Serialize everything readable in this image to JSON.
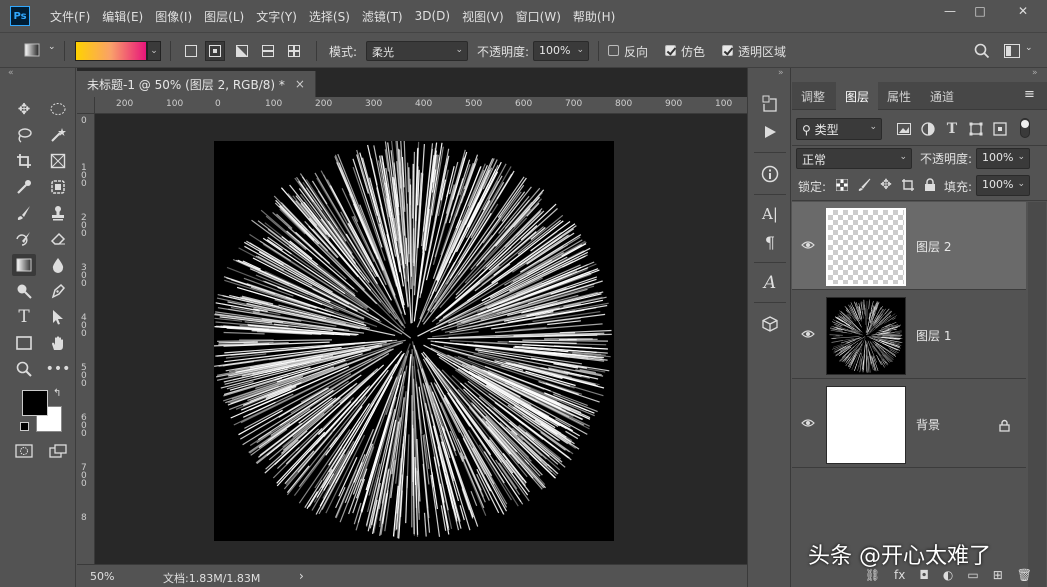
{
  "app": {
    "logo": "Ps"
  },
  "menu": [
    "文件(F)",
    "编辑(E)",
    "图像(I)",
    "图层(L)",
    "文字(Y)",
    "选择(S)",
    "滤镜(T)",
    "3D(D)",
    "视图(V)",
    "窗口(W)",
    "帮助(H)"
  ],
  "window_controls": {
    "minimize": "—",
    "restore": "□",
    "close": "✕"
  },
  "options": {
    "mode_label": "模式:",
    "mode_value": "柔光",
    "opacity_label": "不透明度:",
    "opacity_value": "100%",
    "reverse_label": "反向",
    "dither_label": "仿色",
    "transparency_label": "透明区域",
    "gradient_colors": [
      "#ffd200",
      "#f9a06a",
      "#e8157a"
    ]
  },
  "document": {
    "tab_title": "未标题-1 @ 50% (图层 2, RGB/8) *",
    "close": "×",
    "ruler_h_labels": [
      "200",
      "100",
      "0",
      "100",
      "200",
      "300",
      "400",
      "500",
      "600",
      "700",
      "800",
      "900",
      "100"
    ],
    "ruler_v_labels": [
      "0",
      "1 0 0",
      "2 0 0",
      "3 0 0",
      "4 0 0",
      "5 0 0",
      "6 0 0",
      "7 0 0",
      "8"
    ],
    "zoom": "50%",
    "doc_info": "文档:1.83M/1.83M",
    "status_arrow": "›"
  },
  "layers_panel": {
    "tabs": [
      "调整",
      "图层",
      "属性",
      "通道"
    ],
    "active_tab": "图层",
    "filter_label": "类型",
    "blend_mode": "正常",
    "opacity_label": "不透明度:",
    "opacity_value": "100%",
    "lock_label": "锁定:",
    "fill_label": "填充:",
    "fill_value": "100%",
    "layers": [
      {
        "name": "图层 2",
        "selected": true,
        "thumb": "transparent"
      },
      {
        "name": "图层 1",
        "selected": false,
        "thumb": "burst"
      },
      {
        "name": "背景",
        "selected": false,
        "thumb": "white",
        "locked": true
      }
    ]
  },
  "watermark": "头条 @开心太难了",
  "colors": {
    "panel": "#535353",
    "workspace": "#282828",
    "selected_layer": "#6a6a6a"
  }
}
